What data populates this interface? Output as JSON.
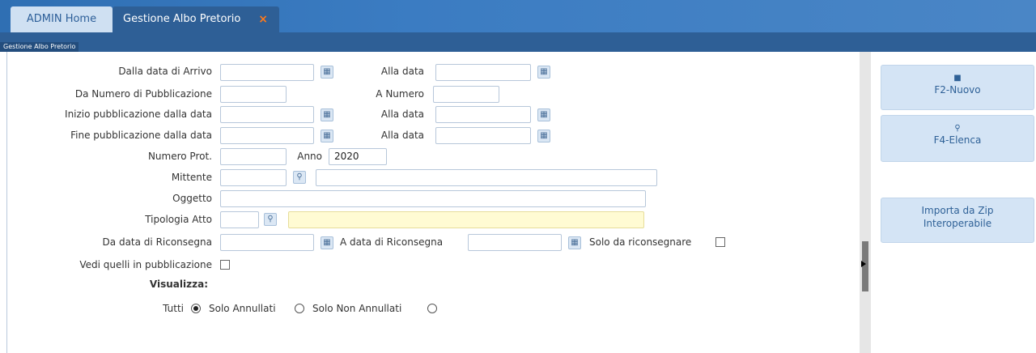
{
  "tabs": {
    "home_label": "ADMIN Home",
    "active_label": "Gestione Albo Pretorio",
    "close_symbol": "×"
  },
  "breadcrumb": "Gestione Albo Pretorio",
  "form": {
    "dalla_data_arrivo": "Dalla data di Arrivo",
    "alla_data": "Alla data",
    "da_numero_pubblicazione": "Da Numero di Pubblicazione",
    "a_numero": "A Numero",
    "inizio_pubblicazione": "Inizio pubblicazione dalla data",
    "fine_pubblicazione": "Fine pubblicazione dalla data",
    "numero_prot": "Numero Prot.",
    "anno": "Anno",
    "anno_value": "2020",
    "mittente": "Mittente",
    "oggetto": "Oggetto",
    "tipologia_atto": "Tipologia Atto",
    "da_data_riconsegna": "Da data di Riconsegna",
    "a_data_riconsegna": "A data di Riconsegna",
    "solo_da_riconsegnare": "Solo da riconsegnare",
    "vedi_quelli": "Vedi quelli in pubblicazione",
    "visualizza": "Visualizza:",
    "tutti": "Tutti",
    "solo_annullati": "Solo Annullati",
    "solo_non_annullati": "Solo Non Annullati",
    "selected_option": "Tutti"
  },
  "sidebar": {
    "nuovo_label": "F2-Nuovo",
    "elenca_label": "F4-Elenca",
    "importa_label_1": "Importa da Zip",
    "importa_label_2": "Interoperabile"
  },
  "icons": {
    "calendar": "calendar-icon",
    "search": "search-icon",
    "new_doc": "document-icon"
  },
  "colors": {
    "header": "#2f6fb3",
    "tab_active": "#2e5f96",
    "tab_home": "#cfe0f2",
    "close": "#ff7a1a",
    "button_bg": "#d4e4f5",
    "highlight_field": "#fffbd3"
  }
}
